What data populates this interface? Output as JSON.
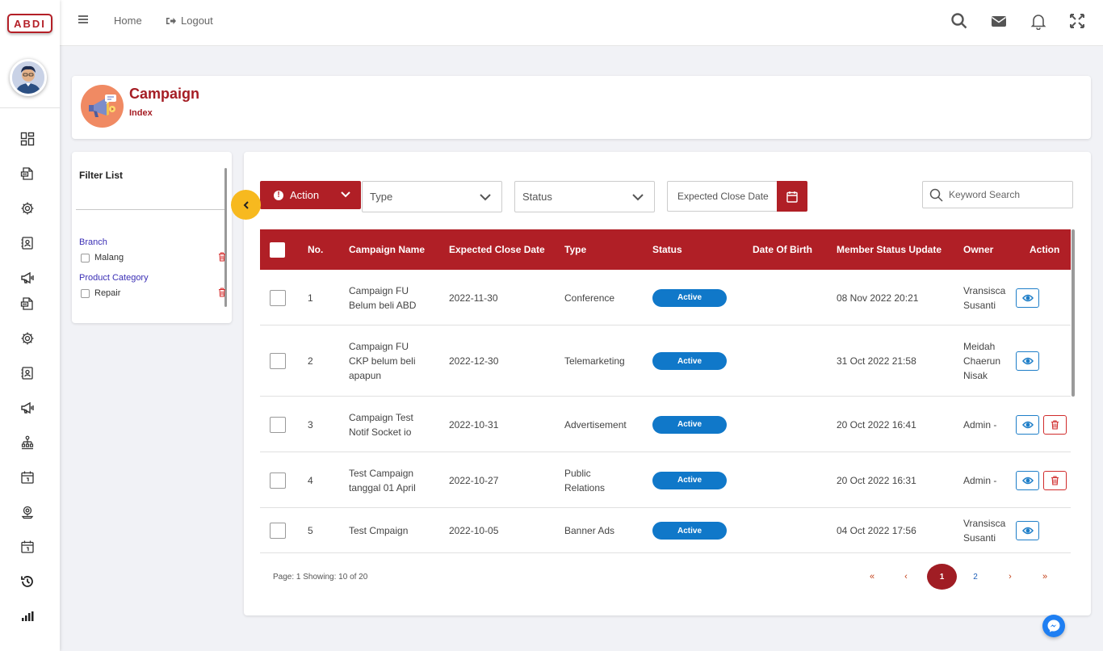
{
  "brand": {
    "logo_text": "ABDI"
  },
  "topbar": {
    "home": "Home",
    "logout": "Logout"
  },
  "header": {
    "title": "Campaign",
    "subtitle": "Index"
  },
  "filter": {
    "title": "Filter List",
    "groups": [
      {
        "label": "Branch",
        "option": "Malang"
      },
      {
        "label": "Product Category",
        "option": "Repair"
      }
    ]
  },
  "toolbar": {
    "action_label": "Action",
    "type_placeholder": "Type",
    "status_placeholder": "Status",
    "date_placeholder": "Expected Close Date",
    "search_placeholder": "Keyword Search"
  },
  "table": {
    "headers": [
      "No.",
      "Campaign Name",
      "Expected Close Date",
      "Type",
      "Status",
      "Date Of Birth",
      "Member Status Update",
      "Owner",
      "Action"
    ],
    "rows": [
      {
        "no": "1",
        "name": [
          "Campaign FU",
          "Belum beli ABD"
        ],
        "date": "2022-11-30",
        "type": [
          "Conference"
        ],
        "status": "Active",
        "dob": "",
        "update": "08 Nov 2022 20:21",
        "owner": [
          "Vransisca",
          "Susanti"
        ],
        "deletable": false
      },
      {
        "no": "2",
        "name": [
          "Campaign FU",
          "CKP belum beli",
          "apapun"
        ],
        "date": "2022-12-30",
        "type": [
          "Telemarketing"
        ],
        "status": "Active",
        "dob": "",
        "update": "31 Oct 2022 21:58",
        "owner": [
          "Meidah",
          "Chaerun",
          "Nisak"
        ],
        "deletable": false
      },
      {
        "no": "3",
        "name": [
          "Campaign Test",
          "Notif Socket io"
        ],
        "date": "2022-10-31",
        "type": [
          "Advertisement"
        ],
        "status": "Active",
        "dob": "",
        "update": "20 Oct 2022 16:41",
        "owner": [
          "Admin -"
        ],
        "deletable": true
      },
      {
        "no": "4",
        "name": [
          "Test Campaign",
          "tanggal 01 April"
        ],
        "date": "2022-10-27",
        "type": [
          "Public",
          "Relations"
        ],
        "status": "Active",
        "dob": "",
        "update": "20 Oct 2022 16:31",
        "owner": [
          "Admin -"
        ],
        "deletable": true
      },
      {
        "no": "5",
        "name": [
          "Test Cmpaign"
        ],
        "date": "2022-10-05",
        "type": [
          "Banner Ads"
        ],
        "status": "Active",
        "dob": "",
        "update": "04 Oct 2022 17:56",
        "owner": [
          "Vransisca",
          "Susanti"
        ],
        "deletable": false
      }
    ]
  },
  "pagination": {
    "info": "Page: 1 Showing: 10 of 20",
    "first": "«",
    "prev": "‹",
    "pages": [
      "1",
      "2"
    ],
    "current": "1",
    "next": "›",
    "last": "»"
  },
  "sidebar_icons": [
    "dashboard-icon",
    "document-icon",
    "settings-icon",
    "contact-icon",
    "megaphone-icon",
    "document-icon",
    "settings-icon",
    "contact-icon",
    "megaphone-icon",
    "workflow-icon",
    "calendar-icon",
    "location-icon",
    "calendar-icon",
    "history-icon",
    "chart-icon"
  ],
  "colors": {
    "primary": "#b01f26",
    "badge": "#1078c9",
    "accent": "#f7b91f"
  }
}
